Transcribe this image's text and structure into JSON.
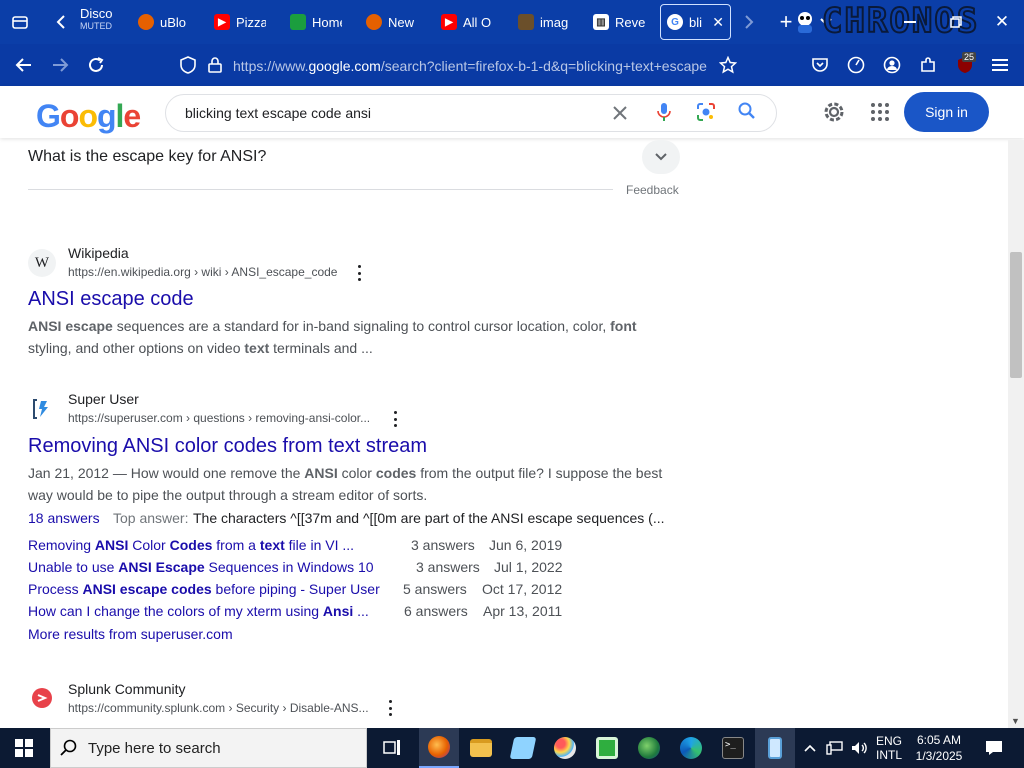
{
  "tabs": [
    {
      "label": "Disco",
      "sub": "MUTED",
      "color": "#5865f2"
    },
    {
      "label": "uBlo",
      "color": "#e66000"
    },
    {
      "label": "Pizza",
      "color": "#ff0000"
    },
    {
      "label": "Home",
      "color": "#1b9e3e"
    },
    {
      "label": "New",
      "color": "#e66000"
    },
    {
      "label": "All O",
      "color": "#ff0000"
    },
    {
      "label": "imag",
      "color": "#6b4f2a"
    },
    {
      "label": "Reve",
      "color": "#333333"
    },
    {
      "label": "bli",
      "color": "#4285f4",
      "active": true
    }
  ],
  "brand_text": "CHRONOS",
  "url": {
    "prefix": "https://www.",
    "domain": "google.com",
    "rest": "/search?client=firefox-b-1-d&q=blicking+text+escape"
  },
  "extension_badge": "25",
  "google": {
    "logo": [
      "G",
      "o",
      "o",
      "g",
      "l",
      "e"
    ],
    "logo_colors": [
      "#4285f4",
      "#ea4335",
      "#fbbc05",
      "#4285f4",
      "#34a853",
      "#ea4335"
    ],
    "query": "blicking text escape code ansi",
    "signin": "Sign in"
  },
  "paa": {
    "question": "What is the escape key for ANSI?",
    "feedback": "Feedback"
  },
  "results": [
    {
      "source": "Wikipedia",
      "cite": "https://en.wikipedia.org › wiki › ANSI_escape_code",
      "title": "ANSI escape code",
      "snippet_line1": [
        "ANSI escape",
        " sequences are a standard for in-band signaling to control cursor location, color, ",
        "font"
      ],
      "snippet_line2": [
        "styling, and other options on video ",
        "text",
        " terminals and ..."
      ]
    },
    {
      "source": "Super User",
      "cite": "https://superuser.com › questions › removing-ansi-color...",
      "title": "Removing ANSI color codes from text stream",
      "snippet_line1": [
        "Jan 21, 2012 — How would one remove the ",
        "ANSI",
        " color ",
        "codes",
        " from the output file? I suppose the best"
      ],
      "snippet_line2": "way would be to pipe the output through a stream editor of sorts.",
      "answers_link": "18 answers",
      "top_answer_label": "Top answer:",
      "top_answer": "The characters ^[[37m and ^[[0m are part of the ANSI escape sequences (...",
      "sitelinks": [
        {
          "parts": [
            "Removing ",
            "ANSI",
            " Color ",
            "Codes",
            " from a ",
            "text",
            " file in VI ..."
          ],
          "answers": "3 answers",
          "date": "Jun 6, 2019"
        },
        {
          "parts": [
            "Unable to use ",
            "ANSI Escape",
            " Sequences in Windows 10"
          ],
          "answers": "3 answers",
          "date": "Jul 1, 2022"
        },
        {
          "parts": [
            "Process ",
            "ANSI escape codes",
            " before piping - Super User"
          ],
          "answers": "5 answers",
          "date": "Oct 17, 2012"
        },
        {
          "parts": [
            "How can I change the colors of my xterm using ",
            "Ansi",
            " ..."
          ],
          "answers": "6 answers",
          "date": "Apr 13, 2011"
        }
      ],
      "more": "More results from superuser.com"
    },
    {
      "source": "Splunk Community",
      "cite": "https://community.splunk.com › Security › Disable-ANS..."
    }
  ],
  "taskbar": {
    "search_placeholder": "Type here to search",
    "lang1": "ENG",
    "lang2": "INTL",
    "time": "6:05 AM",
    "date": "1/3/2025"
  }
}
